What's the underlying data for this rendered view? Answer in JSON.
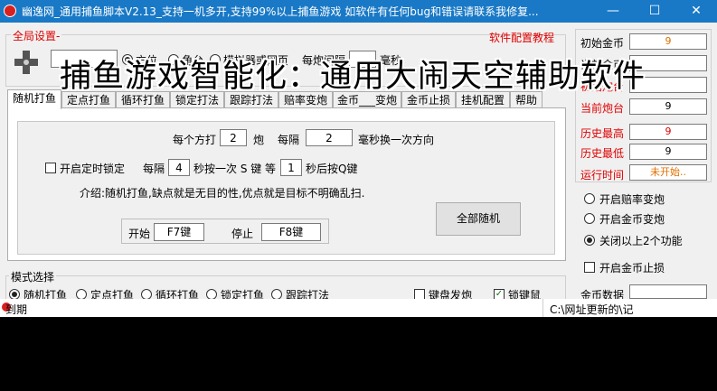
{
  "window": {
    "title": "幽逸网_通用捕鱼脚本V2.13_支持一机多开,支持99%以上捕鱼游戏  如软件有任何bug和错误请联系我修复...",
    "controls": {
      "minimize": "—",
      "maximize": "☐",
      "close": "✕"
    }
  },
  "overlay_text": "捕鱼游戏智能化：通用大闹天空辅助软件",
  "global_settings": {
    "legend": "全局设置-",
    "options": [
      "方位",
      "角台",
      "模拟器或网页",
      "每炮间隔",
      "毫秒"
    ],
    "interval_value": "",
    "config_link": "软件配置教程"
  },
  "tabs": [
    "随机打鱼",
    "定点打鱼",
    "循环打鱼",
    "锁定打法",
    "跟踪打法",
    "赔率变炮",
    "金币___变炮",
    "金币止损",
    "挂机配置",
    "帮助"
  ],
  "active_tab": 0,
  "random_panel": {
    "every_label": "每个方打",
    "every_value": "2",
    "cannon_label": "炮",
    "interval_prefix": "每隔",
    "interval_value": "2",
    "interval_suffix": "毫秒换一次方向",
    "timed_lock_label": "开启定时锁定",
    "lock_every": "每隔",
    "lock_seconds": "4",
    "lock_press": "秒按一次 S 键  等",
    "lock_wait": "1",
    "lock_after": "秒后按Q键",
    "intro": "介绍:随机打鱼,缺点就是无目的性,优点就是目标不明确乱扫.",
    "start_label": "开始",
    "start_key": "F7键",
    "stop_label": "停止",
    "stop_key": "F8键",
    "all_random_button": "全部随机"
  },
  "mode_select": {
    "legend": "模式选择",
    "modes": [
      "随机打鱼",
      "定点打鱼",
      "循环打鱼",
      "锁定打鱼",
      "跟踪打法"
    ],
    "selected": 0,
    "keyboard_fire": "键盘发炮",
    "lock_key": "锁键鼠"
  },
  "right_panel": {
    "stats": [
      {
        "label": "初始金币",
        "value": "9",
        "red": false
      },
      {
        "label": "当前金币",
        "value": "",
        "red": false
      },
      {
        "label": "初始炮台",
        "value": "",
        "red": true
      },
      {
        "label": "当前炮台",
        "value": "9",
        "red": true
      },
      {
        "label": "历史最高",
        "value": "9",
        "red": true
      },
      {
        "label": "历史最低",
        "value": "9",
        "red": true
      },
      {
        "label": "运行时间",
        "value": "未开始..",
        "red": true
      }
    ],
    "options": [
      "开启赔率变炮",
      "开启金币变炮",
      "关闭以上2个功能"
    ],
    "selected_option": 2,
    "stoploss_label": "开启金币止损",
    "gold_data_label": "金币数据"
  },
  "status_bar": {
    "left": "到期",
    "right": "C:\\网址更新的\\记"
  },
  "colors": {
    "titlebar": "#1979c6",
    "accent_red": "#e00000",
    "value_orange": "#e07000"
  }
}
